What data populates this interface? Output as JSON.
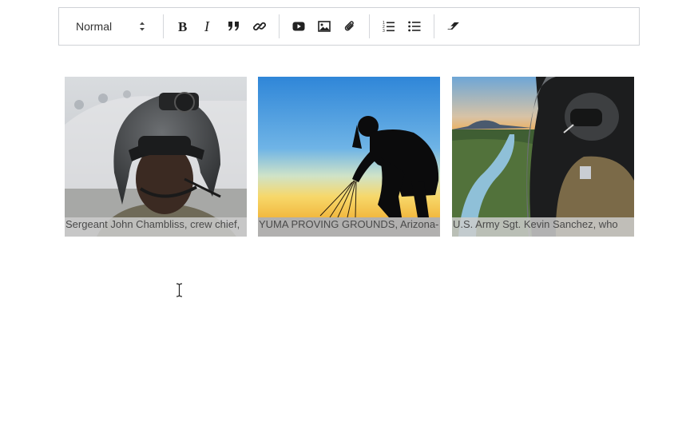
{
  "toolbar": {
    "format_select": {
      "value": "Normal"
    },
    "buttons": {
      "bold": "bold-icon",
      "italic": "italic-icon",
      "blockquote": "quote-icon",
      "link": "link-icon",
      "video": "youtube-icon",
      "image": "image-icon",
      "attachment": "paperclip-icon",
      "ordered_list": "ordered-list-icon",
      "bullet_list": "bullet-list-icon",
      "clear_format": "eraser-icon"
    }
  },
  "gallery": {
    "items": [
      {
        "caption": "Sergeant John Chambliss, crew chief,"
      },
      {
        "caption": "YUMA PROVING GROUNDS, Arizona-"
      },
      {
        "caption": "U.S. Army Sgt. Kevin Sanchez, who"
      }
    ]
  },
  "colors": {
    "toolbar_border": "#cfd2d6",
    "caption_bg": "#cdcdcd",
    "caption_text": "#4a4a4a"
  }
}
